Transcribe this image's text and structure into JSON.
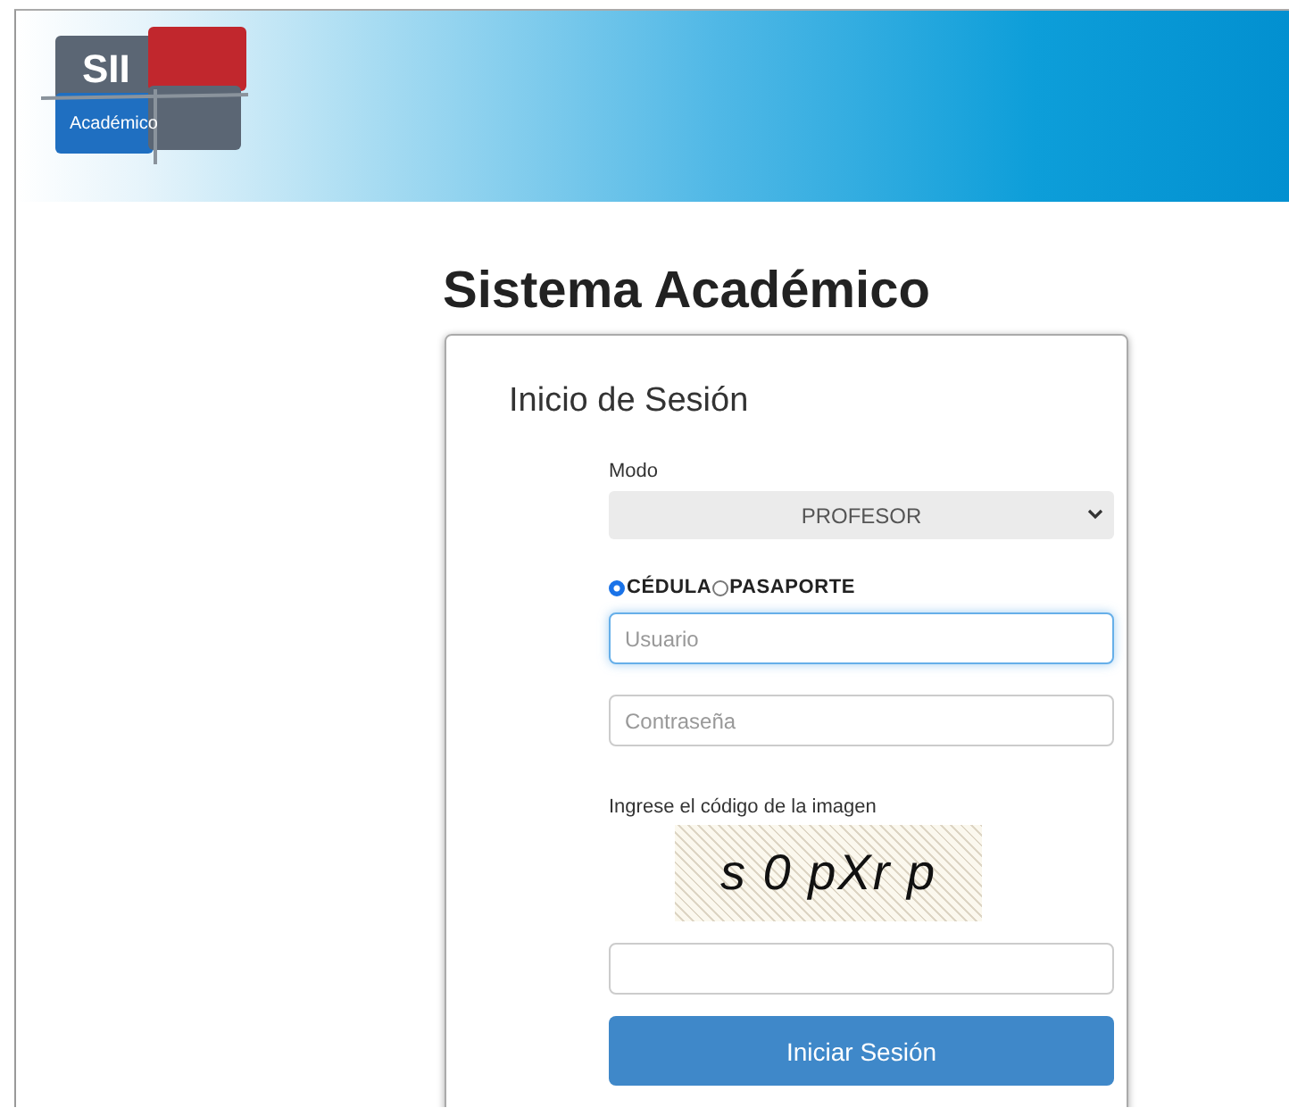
{
  "logo": {
    "top": "SII",
    "bottom": "Académico"
  },
  "title": "Sistema Académico",
  "login": {
    "heading": "Inicio de Sesión",
    "mode_label": "Modo",
    "mode_value": "PROFESOR",
    "id_types": [
      {
        "label": "CÉDULA",
        "selected": true
      },
      {
        "label": "PASAPORTE",
        "selected": false
      }
    ],
    "user": {
      "placeholder": "Usuario",
      "focused": true
    },
    "password": {
      "placeholder": "Contraseña"
    },
    "captcha_label": "Ingrese el código de la imagen",
    "captcha_text": "s 0 pXr p",
    "submit": "Iniciar Sesión"
  }
}
